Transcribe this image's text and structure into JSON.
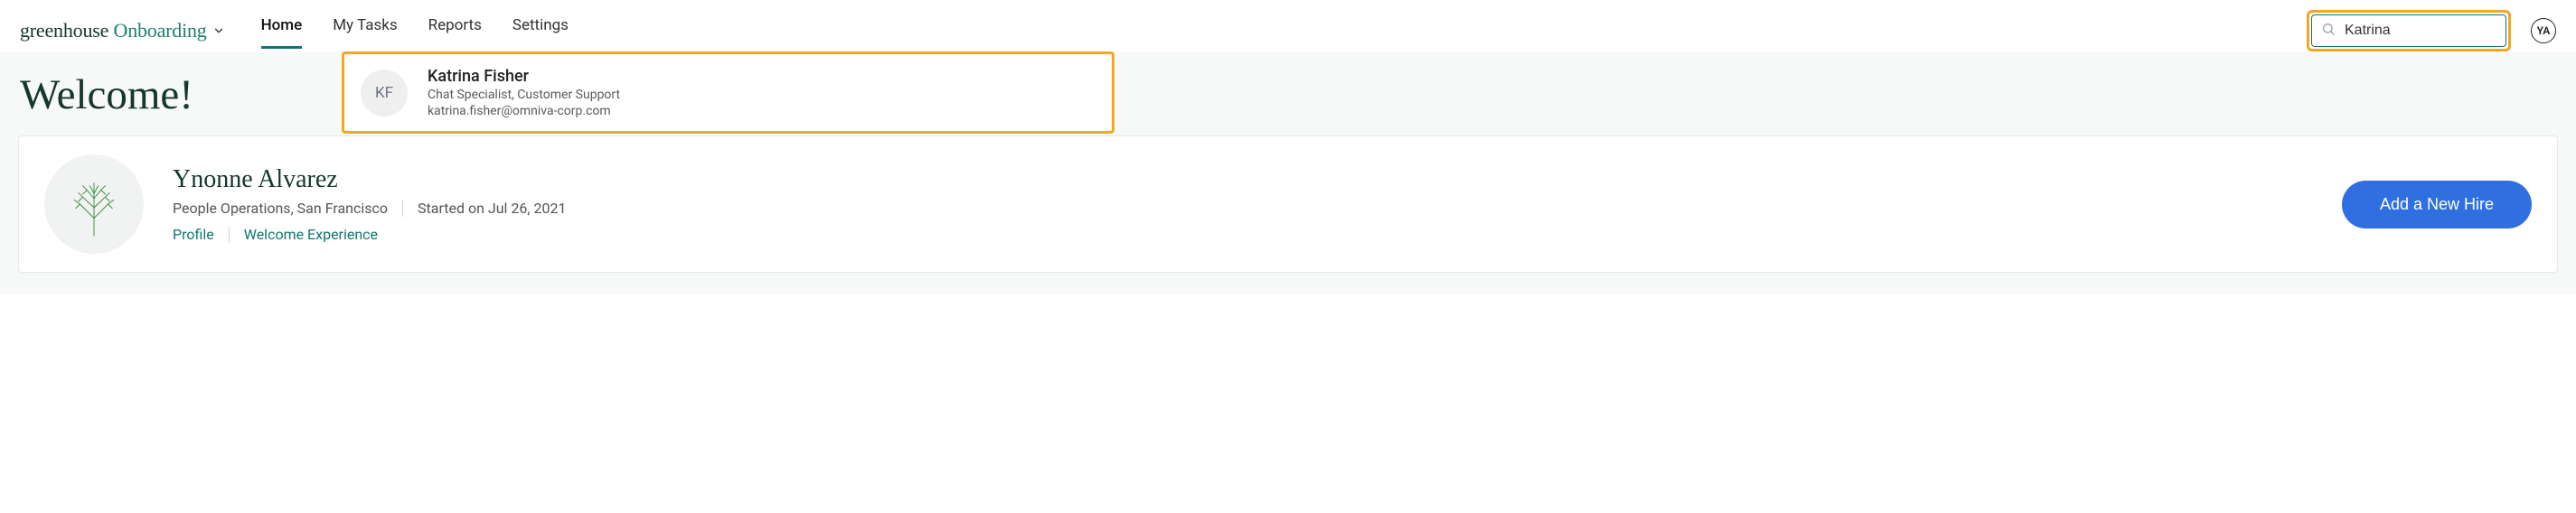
{
  "logo": {
    "part1": "greenhouse",
    "part2": "Onboarding"
  },
  "nav": {
    "items": [
      {
        "label": "Home",
        "active": true
      },
      {
        "label": "My Tasks",
        "active": false
      },
      {
        "label": "Reports",
        "active": false
      },
      {
        "label": "Settings",
        "active": false
      }
    ]
  },
  "search": {
    "value": "Katrina",
    "placeholder": ""
  },
  "current_user": {
    "initials": "YA"
  },
  "page": {
    "title": "Welcome!"
  },
  "profile_card": {
    "name": "Ynonne Alvarez",
    "dept_loc": "People Operations, San Francisco",
    "started": "Started on Jul 26, 2021",
    "link_profile": "Profile",
    "link_welcome": "Welcome Experience",
    "button": "Add a New Hire"
  },
  "search_result": {
    "initials": "KF",
    "name": "Katrina Fisher",
    "role": "Chat Specialist, Customer Support",
    "email": "katrina.fisher@omniva-corp.com"
  }
}
